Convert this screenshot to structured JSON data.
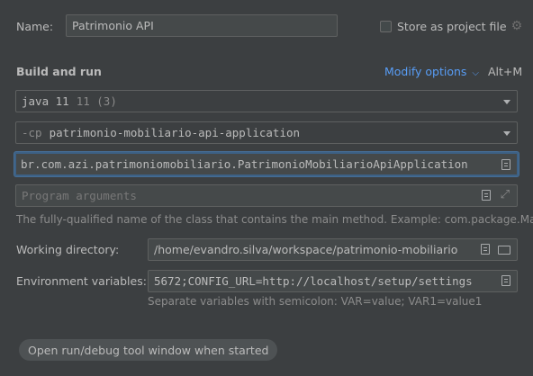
{
  "name_row": {
    "label": "Name:",
    "value": "Patrimonio API",
    "store_checkbox_label": "Store as project file",
    "store_checked": false
  },
  "build_run": {
    "heading": "Build and run",
    "modify_options": "Modify options",
    "modify_shortcut": "Alt+M",
    "jre_main": "java 11",
    "jre_hint": "11 (3)",
    "cp_prefix": "-cp",
    "cp_module": "patrimonio-mobiliario-api-application",
    "main_class": "br.com.azi.patrimoniomobiliario.PatrimonioMobiliarioApiApplication",
    "program_args_placeholder": "Program arguments",
    "main_class_hint": "The fully-qualified name of the class that contains the main method. Example: com.package.Main"
  },
  "working_dir": {
    "label": "Working directory:",
    "value": "/home/evandro.silva/workspace/patrimonio-mobiliario"
  },
  "env_vars": {
    "label": "Environment variables:",
    "value": "5672;CONFIG_URL=http://localhost/setup/settings",
    "hint": "Separate variables with semicolon: VAR=value; VAR1=value1"
  },
  "option_chip": {
    "label": "Open run/debug tool window when started"
  },
  "colors": {
    "background": "#3c3f41",
    "link": "#589df6",
    "focus_border": "#3d6185"
  },
  "icons": [
    "gear-icon",
    "chevron-down-icon",
    "document-icon",
    "expand-icon",
    "folder-icon"
  ]
}
